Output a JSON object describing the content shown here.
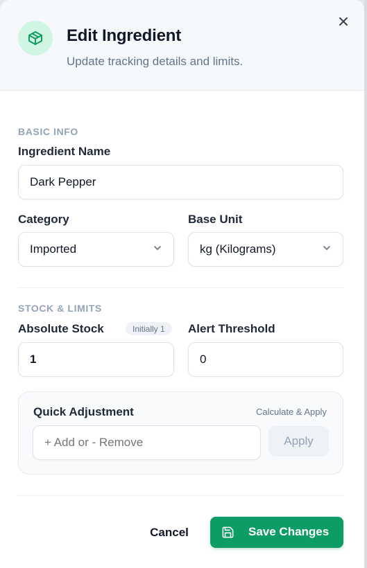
{
  "header": {
    "title": "Edit Ingredient",
    "subtitle": "Update tracking details and limits.",
    "icon": "package-icon",
    "accent_color": "#0d9c64"
  },
  "basic_info": {
    "section_label": "BASIC INFO",
    "name_label": "Ingredient Name",
    "name_value": "Dark Pepper",
    "category_label": "Category",
    "category_value": "Imported",
    "base_unit_label": "Base Unit",
    "base_unit_value": "kg (Kilograms)"
  },
  "stock": {
    "section_label": "STOCK & LIMITS",
    "absolute_stock_label": "Absolute Stock",
    "initial_badge": "Initially 1",
    "absolute_stock_value": "1",
    "alert_threshold_label": "Alert Threshold",
    "alert_threshold_value": "0"
  },
  "quick_adjustment": {
    "title": "Quick Adjustment",
    "hint": "Calculate & Apply",
    "placeholder": "+ Add or - Remove",
    "apply_label": "Apply"
  },
  "footer": {
    "cancel_label": "Cancel",
    "save_label": "Save Changes"
  }
}
